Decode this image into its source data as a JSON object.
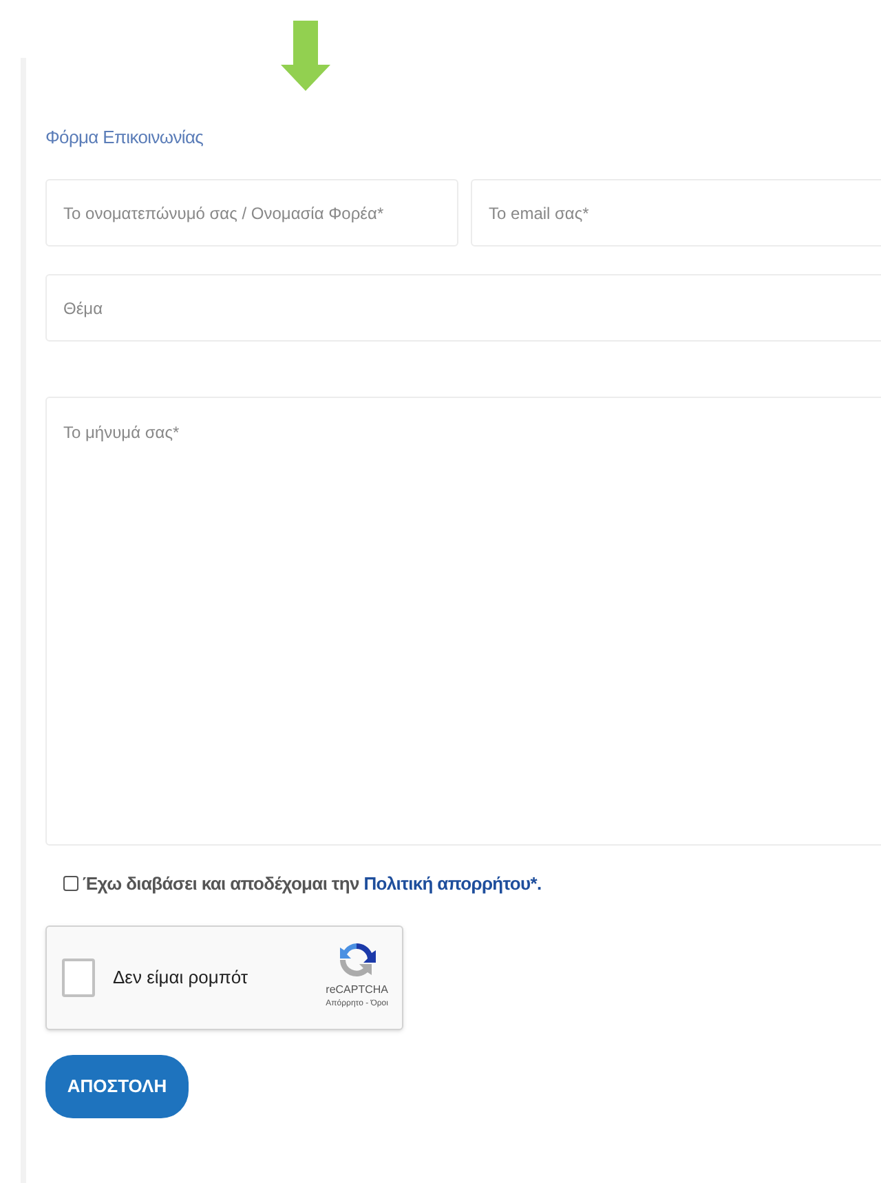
{
  "form_title": "Φόρμα Επικοινωνίας",
  "fields": [
    {
      "kind": "input",
      "placeholder": "Το ονοματεπώνυμό σας / Ονομασία Φορέα*"
    },
    {
      "kind": "input",
      "placeholder": "Το email σας*"
    },
    {
      "kind": "input",
      "placeholder": "Θέμα"
    },
    {
      "kind": "textarea",
      "placeholder": "Το μήνυμά σας*"
    }
  ],
  "consent": {
    "checked": false,
    "text": "Έχω διαβάσει και αποδέχομαι την ",
    "link": "Πολιτική απορρήτου",
    "suffix": "*."
  },
  "captcha": {
    "checked": false,
    "label": "Δεν είμαι ρομπότ",
    "brand": "reCAPTCHA",
    "links": "Απόρρητο - Όροι"
  },
  "submit": "ΑΠΟΣΤΟΛΗ"
}
